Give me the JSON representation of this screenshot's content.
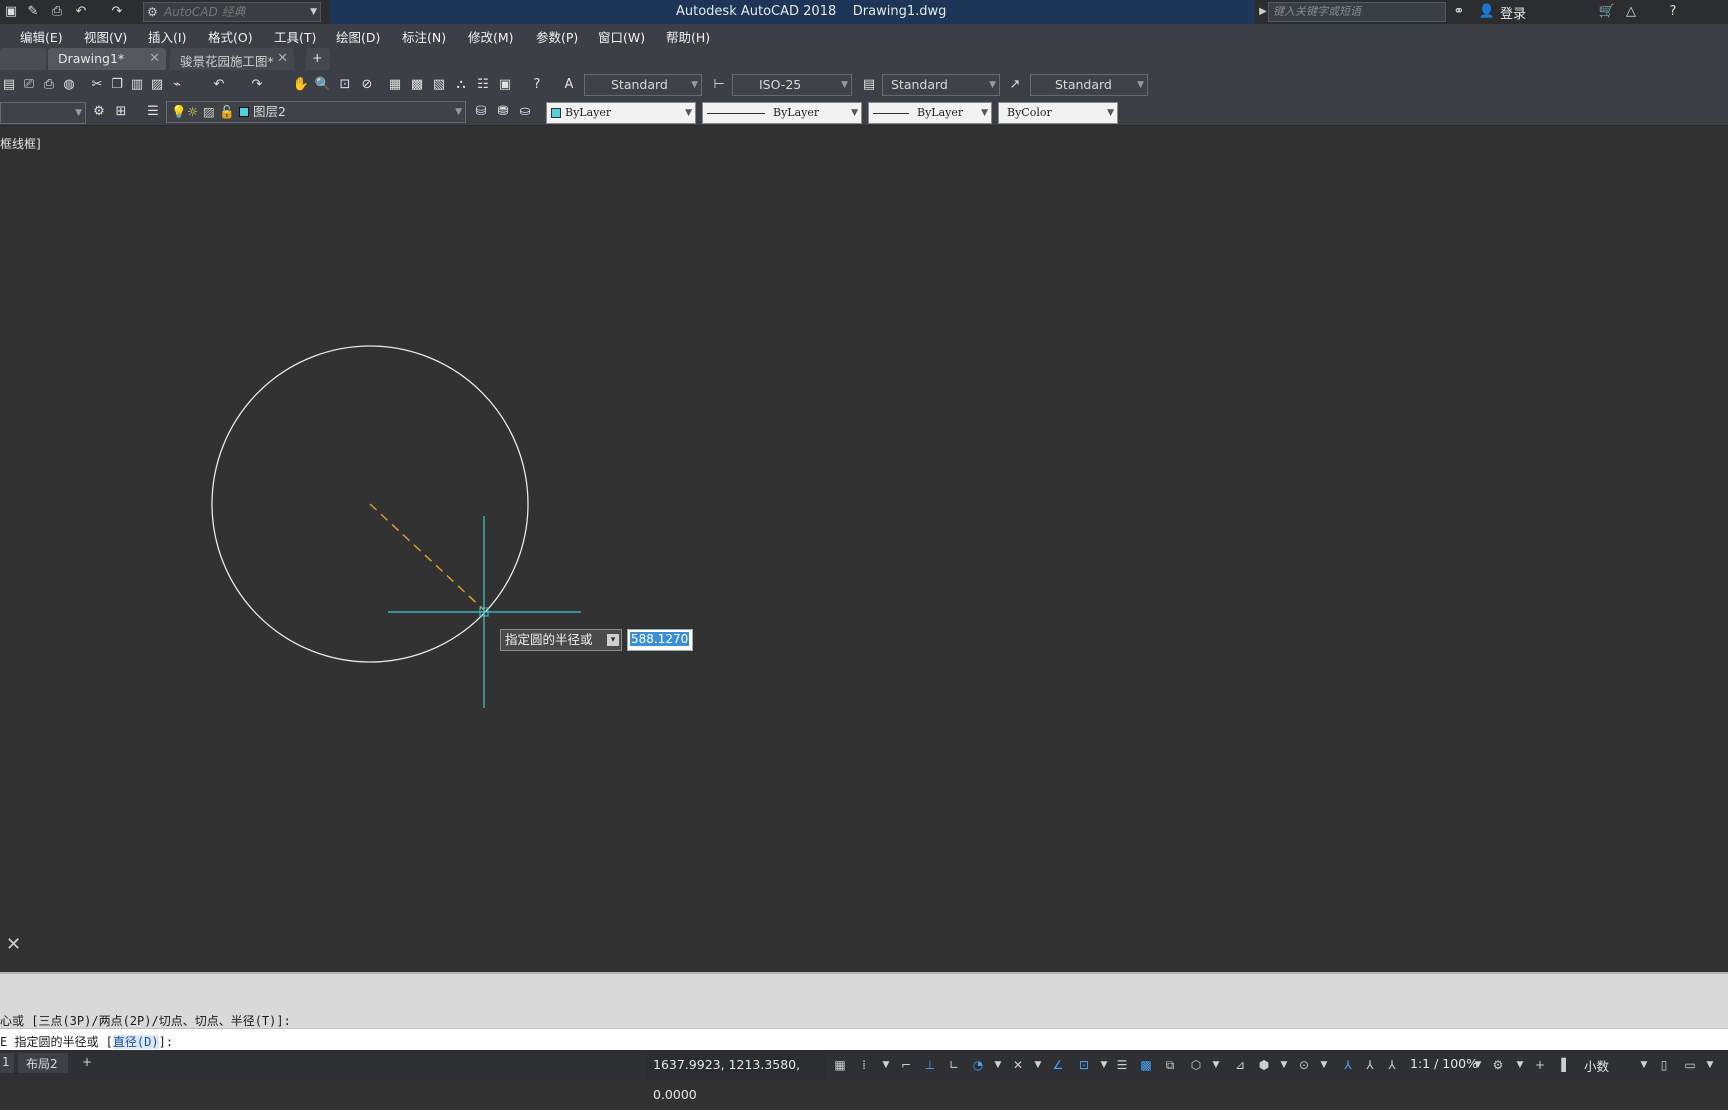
{
  "titlebar": {
    "workspace": "AutoCAD 经典",
    "title": "Autodesk AutoCAD 2018    Drawing1.dwg",
    "search_placeholder": "键入关键字或短语",
    "login": "登录"
  },
  "menu": [
    "编辑(E)",
    "视图(V)",
    "插入(I)",
    "格式(O)",
    "工具(T)",
    "绘图(D)",
    "标注(N)",
    "修改(M)",
    "参数(P)",
    "窗口(W)",
    "帮助(H)"
  ],
  "tabs": {
    "active": "Drawing1*",
    "other": "骏景花园施工图*",
    "add": "+"
  },
  "styles": {
    "text_style": "Standard",
    "dim_style": "ISO-25",
    "table_style": "Standard",
    "mleader_style": "Standard"
  },
  "layers": {
    "current_layer": "图层2",
    "color": "ByLayer",
    "linetype": "ByLayer",
    "lineweight": "ByLayer",
    "plotstyle": "ByColor",
    "layer_color_hex": "#4fd1e0"
  },
  "viewport": {
    "label": "框线框]"
  },
  "dynamic_input": {
    "prompt": "指定圆的半径或",
    "value": "588.1270"
  },
  "command": {
    "history": "心或 [三点(3P)/两点(2P)/切点、切点、半径(T)]:",
    "current_prefix": "E 指定圆的半径或 [",
    "current_option": "直径(D)",
    "current_suffix": "]:"
  },
  "statusbar": {
    "layout_tabs": [
      "1",
      "布局2",
      "+"
    ],
    "coordinates": "1637.9923, 1213.3580, 0.0000",
    "annotation_scale": "1:1 / 100%",
    "units": "小数"
  },
  "colors": {
    "canvas": "#323232",
    "crosshair": "#3fc9d6",
    "rubberband": "#e0a030",
    "circle": "#e8e8e8"
  }
}
